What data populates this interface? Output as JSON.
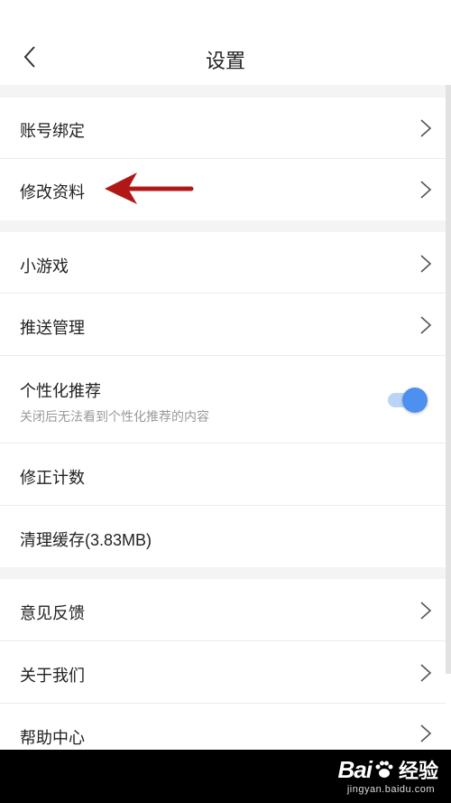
{
  "header": {
    "title": "设置"
  },
  "sections": {
    "account": {
      "items": [
        {
          "label": "账号绑定"
        },
        {
          "label": "修改资料"
        }
      ]
    },
    "general": {
      "items": [
        {
          "label": "小游戏"
        },
        {
          "label": "推送管理"
        },
        {
          "label": "个性化推荐",
          "sublabel": "关闭后无法看到个性化推荐的内容",
          "toggle_on": true
        },
        {
          "label": "修正计数"
        },
        {
          "label": "清理缓存(3.83MB)"
        }
      ]
    },
    "help": {
      "items": [
        {
          "label": "意见反馈"
        },
        {
          "label": "关于我们"
        },
        {
          "label": "帮助中心"
        }
      ]
    }
  },
  "icons": {
    "back": "chevron-left-icon",
    "row_arrow": "chevron-right-icon",
    "annotation": "red-arrow-icon"
  },
  "colors": {
    "accent": "#4d90f0",
    "annotation_arrow": "#b01818",
    "section_gap": "#f4f4f4"
  },
  "watermark": {
    "brand": "Bai",
    "brand_suffix": "经验",
    "url": "jingyan.baidu.com"
  }
}
